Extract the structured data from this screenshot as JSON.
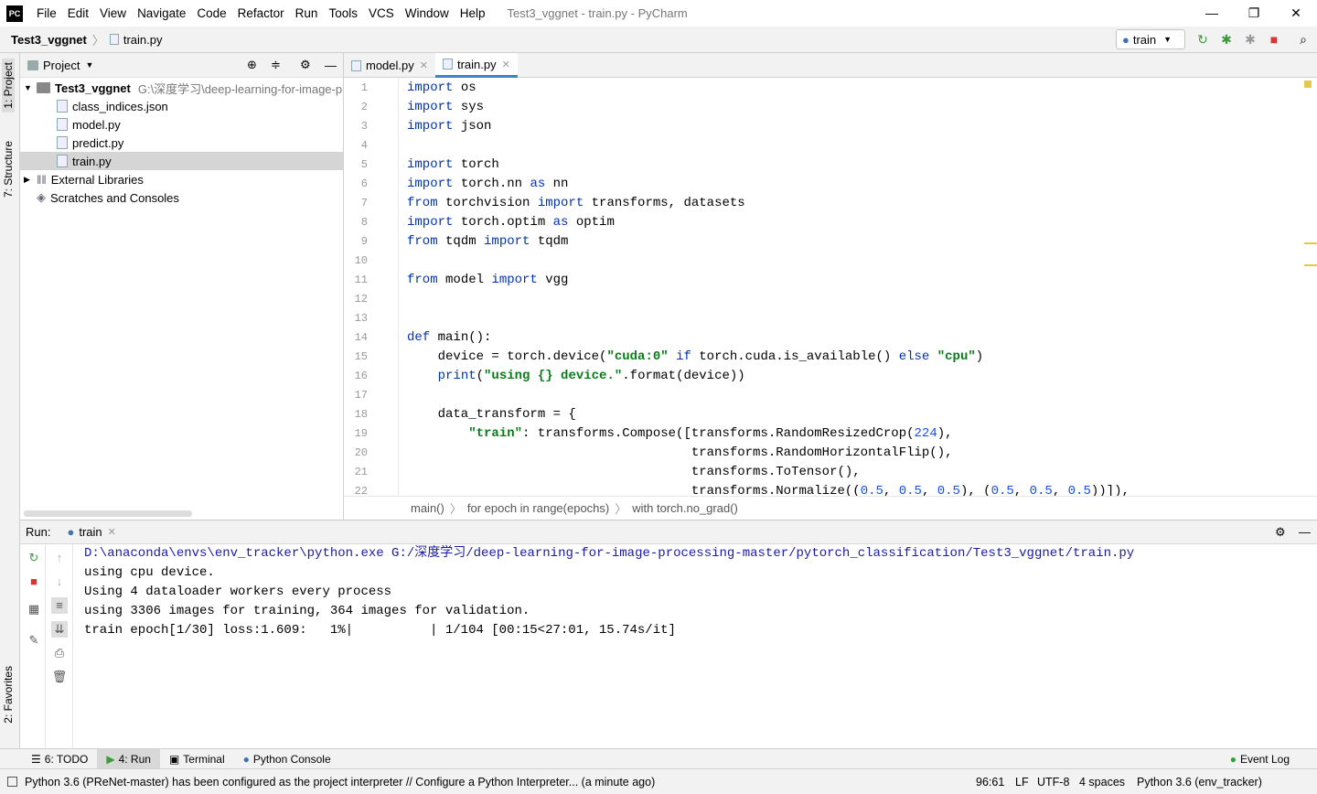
{
  "menubar": {
    "logo": "PC",
    "items": [
      "File",
      "Edit",
      "View",
      "Navigate",
      "Code",
      "Refactor",
      "Run",
      "Tools",
      "VCS",
      "Window",
      "Help"
    ],
    "title": "Test3_vggnet - train.py - PyCharm",
    "minimize": "—",
    "maximize": "❐",
    "close": "✕"
  },
  "navbar": {
    "project": "Test3_vggnet",
    "file": "train.py",
    "run_config": "train"
  },
  "left_tabs": {
    "project": "1: Project",
    "structure": "7: Structure",
    "favorites": "2: Favorites"
  },
  "project_panel": {
    "title": "Project",
    "root": "Test3_vggnet",
    "root_path": "G:\\深度学习\\deep-learning-for-image-p",
    "files": [
      "class_indices.json",
      "model.py",
      "predict.py",
      "train.py"
    ],
    "external": "External Libraries",
    "scratches": "Scratches and Consoles"
  },
  "editor": {
    "tabs": [
      "model.py",
      "train.py"
    ],
    "breadcrumb": [
      "main()",
      "for epoch in range(epochs)",
      "with torch.no_grad()"
    ]
  },
  "run_panel": {
    "label": "Run:",
    "tab": "train",
    "output": [
      "D:\\anaconda\\envs\\env_tracker\\python.exe G:/深度学习/deep-learning-for-image-processing-master/pytorch_classification/Test3_vggnet/train.py",
      "using cpu device.",
      "Using 4 dataloader workers every process",
      "using 3306 images for training, 364 images for validation.",
      "train epoch[1/30] loss:1.609:   1%|          | 1/104 [00:15<27:01, 15.74s/it]"
    ]
  },
  "bottom_tabs": {
    "todo": "6: TODO",
    "run": "4: Run",
    "terminal": "Terminal",
    "console": "Python Console",
    "event_log": "Event Log"
  },
  "status": {
    "message": "Python 3.6 (PReNet-master) has been configured as the project interpreter // Configure a Python Interpreter... (a minute ago)",
    "position": "96:61",
    "line_sep": "LF",
    "encoding": "UTF-8",
    "indent": "4 spaces",
    "interpreter": "Python 3.6 (env_tracker)"
  }
}
